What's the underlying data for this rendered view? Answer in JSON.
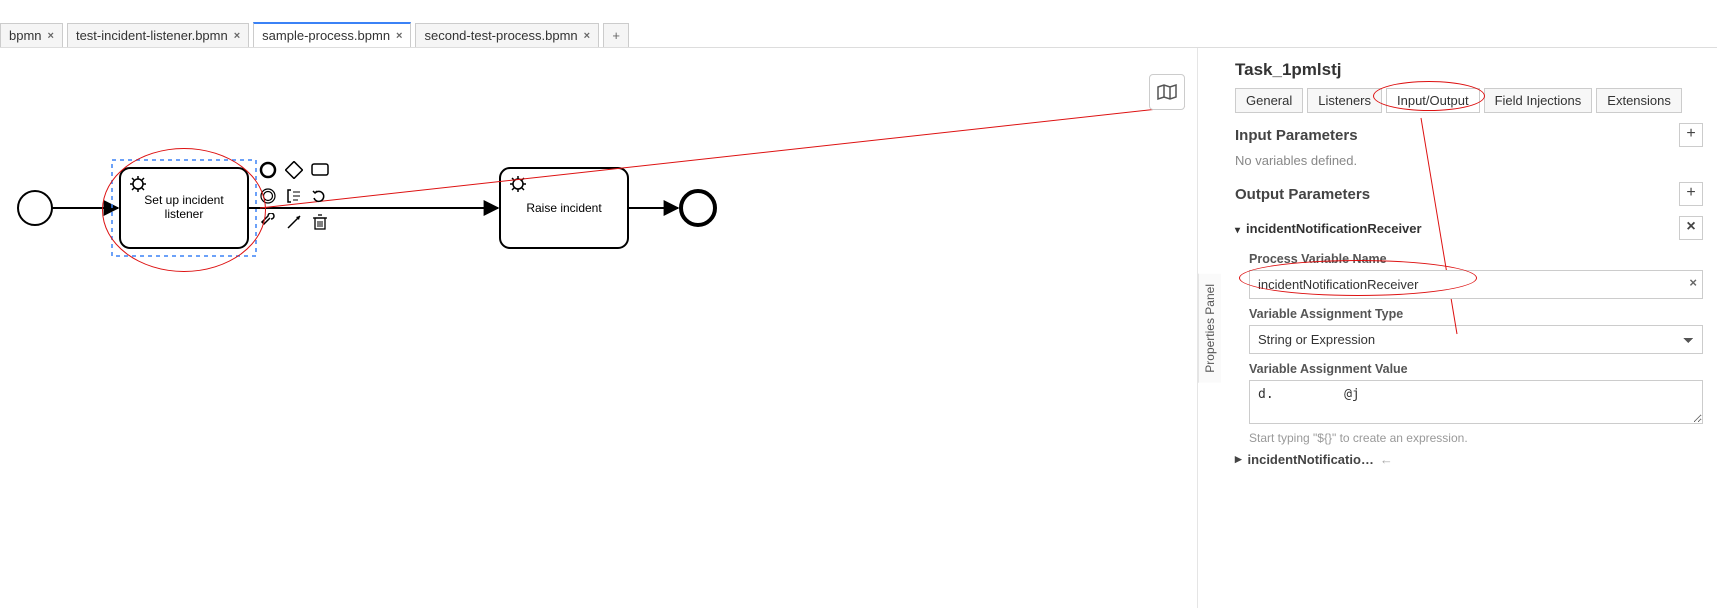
{
  "tabs": {
    "items": [
      {
        "label": "bpmn",
        "active": false
      },
      {
        "label": "test-incident-listener.bpmn",
        "active": false
      },
      {
        "label": "sample-process.bpmn",
        "active": true
      },
      {
        "label": "second-test-process.bpmn",
        "active": false
      }
    ],
    "close_glyph": "×",
    "add_glyph": "+"
  },
  "canvas": {
    "task1_line1": "Set up incident",
    "task1_line2": "listener",
    "task2": "Raise incident"
  },
  "minimap_btn_title": "Toggle minimap",
  "properties_panel_label": "Properties Panel",
  "panel": {
    "title": "Task_1pmlstj",
    "tabs": {
      "general": "General",
      "listeners": "Listeners",
      "io": "Input/Output",
      "field_inj": "Field Injections",
      "extensions": "Extensions"
    },
    "input_params": {
      "heading": "Input Parameters",
      "empty": "No variables defined."
    },
    "output_params": {
      "heading": "Output Parameters",
      "item1": {
        "name": "incidentNotificationReceiver",
        "proc_var_label": "Process Variable Name",
        "proc_var_value": "incidentNotificationReceiver",
        "assign_type_label": "Variable Assignment Type",
        "assign_type_value": "String or Expression",
        "assign_val_label": "Variable Assignment Value",
        "assign_val_value": "d.         @j",
        "hint": "Start typing \"${}\" to create an expression."
      },
      "item2": {
        "name": "incidentNotificatio…"
      }
    },
    "add_glyph": "+",
    "remove_glyph": "×",
    "arrow_glyph": "←"
  }
}
